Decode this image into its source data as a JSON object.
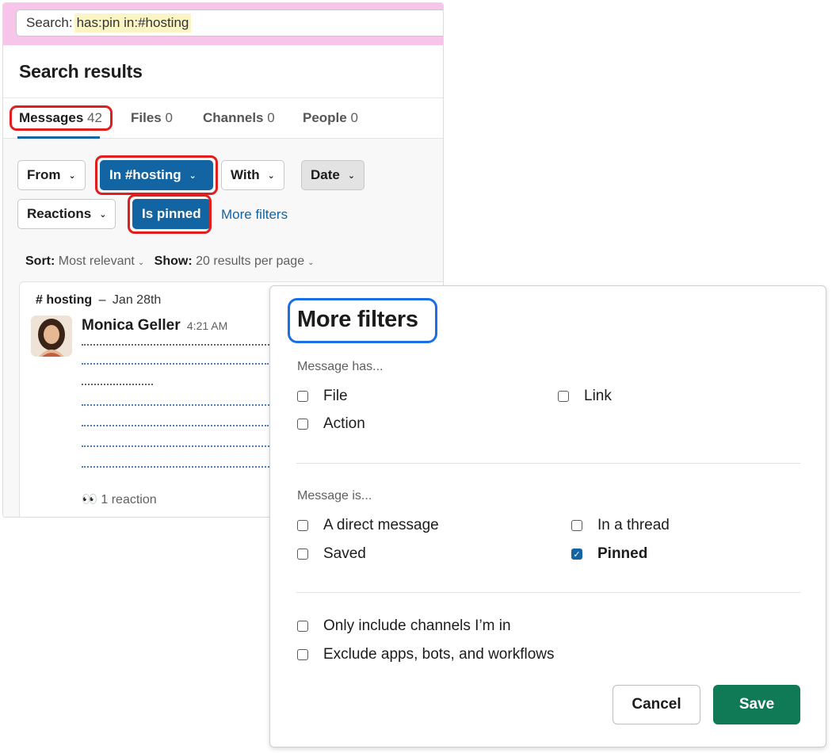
{
  "search": {
    "prefix": "Search:",
    "query": "has:pin in:#hosting"
  },
  "results": {
    "title": "Search results",
    "tabs": [
      {
        "label": "Messages",
        "count": "42"
      },
      {
        "label": "Files",
        "count": "0"
      },
      {
        "label": "Channels",
        "count": "0"
      },
      {
        "label": "People",
        "count": "0"
      }
    ],
    "filters": {
      "from": "From",
      "in": "In #hosting",
      "with": "With",
      "date": "Date",
      "reactions": "Reactions",
      "is_pinned": "Is pinned",
      "more": "More filters"
    },
    "sort": {
      "sort_label": "Sort:",
      "sort_value": "Most relevant",
      "show_label": "Show:",
      "show_value": "20 results per page"
    },
    "message": {
      "channel": "# hosting",
      "separator": "–",
      "date": "Jan 28th",
      "author": "Monica Geller",
      "time": "4:21 AM",
      "reaction": "👀 1 reaction"
    }
  },
  "modal": {
    "title": "More filters",
    "has_label": "Message has...",
    "has_options": {
      "file": "File",
      "link": "Link",
      "action": "Action"
    },
    "is_label": "Message is...",
    "is_options": {
      "direct": "A direct message",
      "thread": "In a thread",
      "saved": "Saved",
      "pinned": "Pinned"
    },
    "other_options": {
      "channels": "Only include channels I’m in",
      "exclude": "Exclude apps, bots, and workflows"
    },
    "cancel": "Cancel",
    "save": "Save"
  },
  "colors": {
    "accent_blue": "#1264a3",
    "save_green": "#107a56",
    "search_pink": "#f7c5ea",
    "highlight_red": "#e01e1e",
    "highlight_blue": "#1a6ee8"
  }
}
